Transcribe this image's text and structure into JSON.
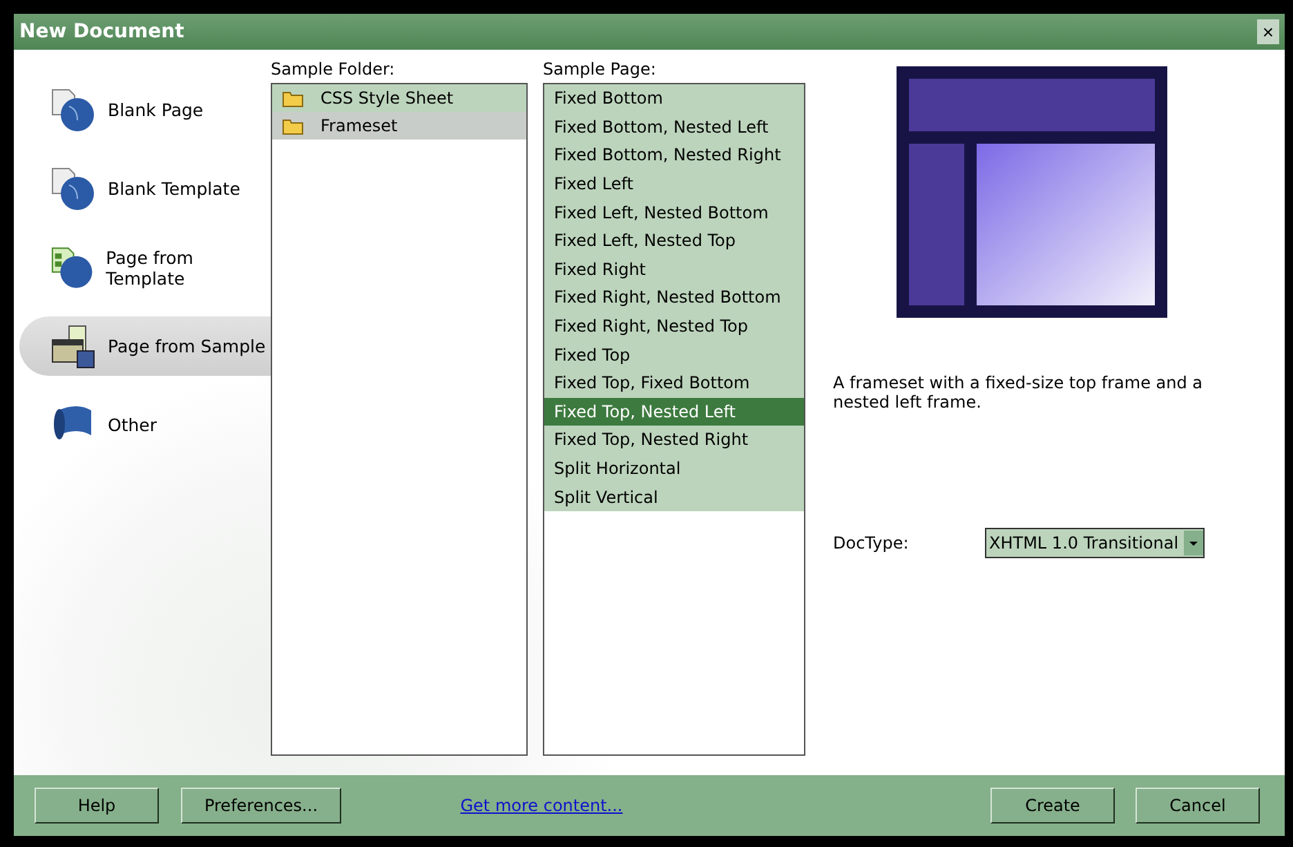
{
  "window": {
    "title": "New Document",
    "close": "×"
  },
  "categories": [
    {
      "label": "Blank Page",
      "kind": "blank-page",
      "selected": false
    },
    {
      "label": "Blank Template",
      "kind": "blank-template",
      "selected": false
    },
    {
      "label": "Page from Template",
      "kind": "template",
      "selected": false
    },
    {
      "label": "Page from Sample",
      "kind": "sample",
      "selected": true
    },
    {
      "label": "Other",
      "kind": "other",
      "selected": false
    }
  ],
  "sample_folder": {
    "label": "Sample Folder:",
    "items": [
      {
        "label": "CSS Style Sheet",
        "selected": false
      },
      {
        "label": "Frameset",
        "selected": true
      }
    ]
  },
  "sample_page": {
    "label": "Sample Page:",
    "items": [
      {
        "label": "Fixed Bottom",
        "selected": false
      },
      {
        "label": "Fixed Bottom, Nested Left",
        "selected": false
      },
      {
        "label": "Fixed Bottom, Nested Right",
        "selected": false
      },
      {
        "label": "Fixed Left",
        "selected": false
      },
      {
        "label": "Fixed Left, Nested Bottom",
        "selected": false
      },
      {
        "label": "Fixed Left, Nested Top",
        "selected": false
      },
      {
        "label": "Fixed Right",
        "selected": false
      },
      {
        "label": "Fixed Right, Nested Bottom",
        "selected": false
      },
      {
        "label": "Fixed Right, Nested Top",
        "selected": false
      },
      {
        "label": "Fixed Top",
        "selected": false
      },
      {
        "label": "Fixed Top, Fixed Bottom",
        "selected": false
      },
      {
        "label": "Fixed Top, Nested Left",
        "selected": true
      },
      {
        "label": "Fixed Top, Nested Right",
        "selected": false
      },
      {
        "label": "Split Horizontal",
        "selected": false
      },
      {
        "label": "Split Vertical",
        "selected": false
      }
    ]
  },
  "preview": {
    "description": "A frameset with a fixed-size top frame and a nested left frame."
  },
  "doctype": {
    "label": "DocType:",
    "value": "XHTML 1.0 Transitional"
  },
  "footer": {
    "help": "Help",
    "preferences": "Preferences...",
    "link": "Get more content...",
    "create": "Create",
    "cancel": "Cancel"
  }
}
